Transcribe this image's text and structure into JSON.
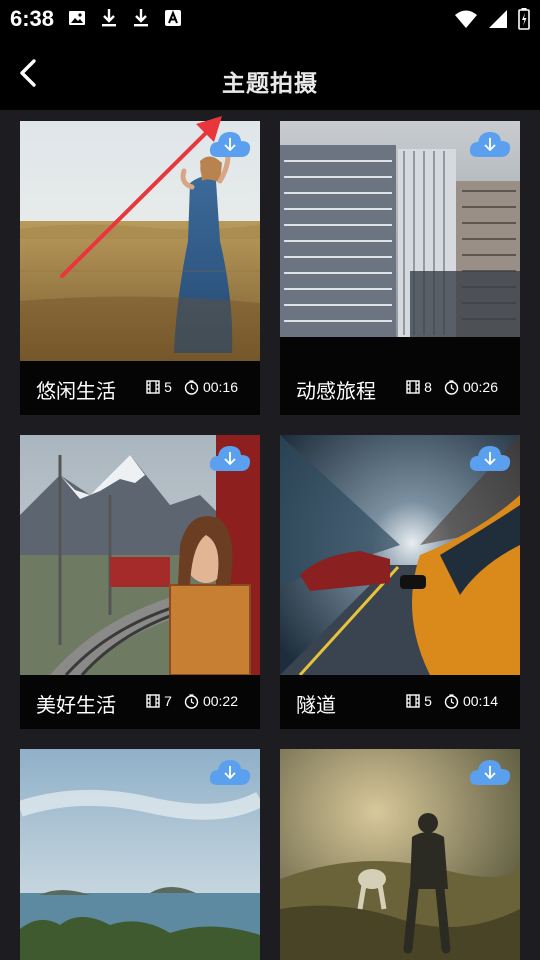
{
  "status_bar": {
    "time": "6:38"
  },
  "header": {
    "title": "主题拍摄"
  },
  "cards": [
    {
      "title": "悠闲生活",
      "clips": "5",
      "duration": "00:16"
    },
    {
      "title": "动感旅程",
      "clips": "8",
      "duration": "00:26"
    },
    {
      "title": "美好生活",
      "clips": "7",
      "duration": "00:22"
    },
    {
      "title": "隧道",
      "clips": "5",
      "duration": "00:14"
    }
  ],
  "icons": {
    "back": "chevron-left-icon",
    "download": "cloud-download-icon",
    "clips": "film-icon",
    "duration": "clock-icon"
  },
  "colors": {
    "download_badge": "#5aa0ef",
    "annotation_arrow": "#e8363c"
  }
}
